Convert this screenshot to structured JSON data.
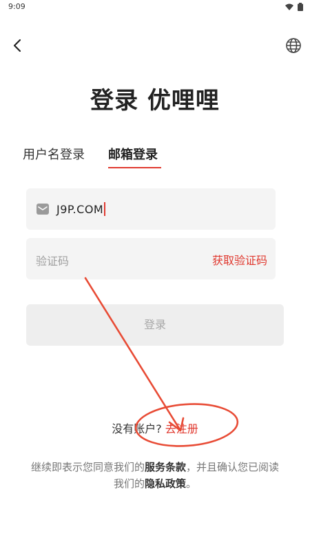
{
  "status_bar": {
    "time": "9:09",
    "icons": [
      "wifi-icon",
      "battery-icon"
    ]
  },
  "header": {
    "back_icon": "chevron-left-icon",
    "language_icon": "globe-icon"
  },
  "title": "登录 优哩哩",
  "tabs": [
    {
      "label": "用户名登录",
      "active": false
    },
    {
      "label": "邮箱登录",
      "active": true
    }
  ],
  "email_field": {
    "icon": "mail-icon",
    "value": "J9P.COM"
  },
  "code_field": {
    "placeholder": "验证码",
    "get_code_label": "获取验证码"
  },
  "login_button": {
    "label": "登录"
  },
  "register": {
    "prompt": "没有账户?",
    "link": "去注册"
  },
  "agreement": {
    "part1": "继续即表示您同意我们的",
    "terms": "服务条款",
    "part2": "，并且确认您已阅读",
    "part3": "我们的",
    "privacy": "隐私政策",
    "end": "。"
  },
  "colors": {
    "accent": "#e0382e",
    "field_bg": "#f4f4f4",
    "button_disabled_bg": "#eeeeee"
  }
}
